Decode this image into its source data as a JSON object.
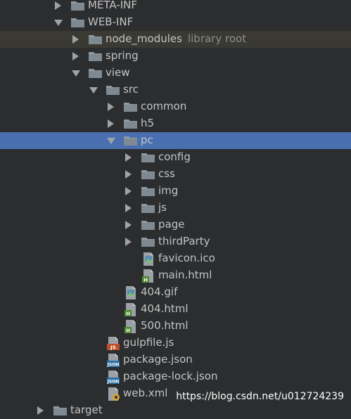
{
  "tree": {
    "items": [
      {
        "label": "META-INF",
        "state": "collapsed",
        "kind": "folder",
        "depth": 0
      },
      {
        "label": "WEB-INF",
        "state": "expanded",
        "kind": "folder",
        "depth": 0
      },
      {
        "label": "node_modules",
        "hint": "library root",
        "state": "collapsed",
        "kind": "folder",
        "depth": 1
      },
      {
        "label": "spring",
        "state": "collapsed",
        "kind": "folder",
        "depth": 1
      },
      {
        "label": "view",
        "state": "expanded",
        "kind": "folder",
        "depth": 1
      },
      {
        "label": "src",
        "state": "expanded",
        "kind": "folder",
        "depth": 2
      },
      {
        "label": "common",
        "state": "collapsed",
        "kind": "folder",
        "depth": 3
      },
      {
        "label": "h5",
        "state": "collapsed",
        "kind": "folder",
        "depth": 3
      },
      {
        "label": "pc",
        "state": "expanded",
        "kind": "folder",
        "depth": 3
      },
      {
        "label": "config",
        "state": "collapsed",
        "kind": "folder",
        "depth": 4
      },
      {
        "label": "css",
        "state": "collapsed",
        "kind": "folder",
        "depth": 4
      },
      {
        "label": "img",
        "state": "collapsed",
        "kind": "folder",
        "depth": 4
      },
      {
        "label": "js",
        "state": "collapsed",
        "kind": "folder",
        "depth": 4
      },
      {
        "label": "page",
        "state": "collapsed",
        "kind": "folder",
        "depth": 4
      },
      {
        "label": "thirdParty",
        "state": "collapsed",
        "kind": "folder",
        "depth": 4
      },
      {
        "label": "favicon.ico",
        "kind": "image-file",
        "depth": 4
      },
      {
        "label": "main.html",
        "kind": "html-file",
        "depth": 4
      },
      {
        "label": "404.gif",
        "kind": "image-file",
        "depth": 3
      },
      {
        "label": "404.html",
        "kind": "html-file",
        "depth": 3
      },
      {
        "label": "500.html",
        "kind": "html-file",
        "depth": 3
      },
      {
        "label": "gulpfile.js",
        "kind": "js-file",
        "depth": 2
      },
      {
        "label": "package.json",
        "kind": "json-file",
        "depth": 2
      },
      {
        "label": "package-lock.json",
        "kind": "json-file",
        "depth": 2
      },
      {
        "label": "web.xml",
        "kind": "xml-file",
        "depth": 2
      },
      {
        "label": "target",
        "state": "collapsed",
        "kind": "folder",
        "depth": -1
      }
    ],
    "selected_label": "pc",
    "excluded_label": "node_modules"
  },
  "icons": {
    "folder": "folder-icon",
    "image-file": "image-file-icon",
    "html-file": "html-file-icon",
    "js-file": "js-file-icon",
    "json-file": "json-file-icon",
    "xml-file": "xml-file-icon",
    "collapsed": "chevron-right-icon",
    "expanded": "chevron-down-icon"
  },
  "colors": {
    "background": "#2b2d2f",
    "selection": "#4a6fb1",
    "excluded": "#3a3a32",
    "folder": "#8f9aa3",
    "js_badge": "#c0502a",
    "json_badge": "#2e6fa3",
    "html_badge": "#4c8a2c"
  },
  "watermark": "https://blog.csdn.net/u012724239"
}
